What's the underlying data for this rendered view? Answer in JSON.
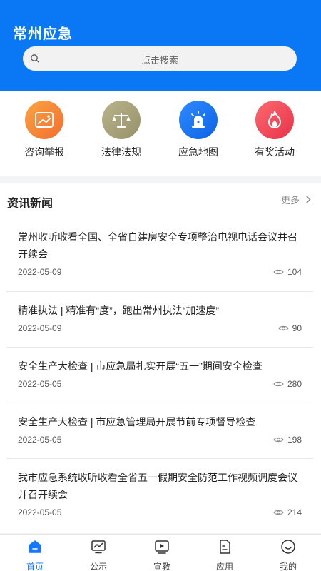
{
  "header": {
    "title": "常州应急",
    "search_placeholder": "点击搜索"
  },
  "quick_links": [
    {
      "label": "咨询举报",
      "icon": "report-icon",
      "color": "#f7873a"
    },
    {
      "label": "法律法规",
      "icon": "scale-icon",
      "color": "#a9a478"
    },
    {
      "label": "应急地图",
      "icon": "alarm-icon",
      "color": "#1677ff"
    },
    {
      "label": "有奖活动",
      "icon": "flame-icon",
      "color": "#f04a5a"
    }
  ],
  "news": {
    "title": "资讯新闻",
    "more": "更多",
    "items": [
      {
        "title": "常州收听收看全国、全省自建房安全专项整治电视电话会议并召开续会",
        "date": "2022-05-09",
        "views": "104"
      },
      {
        "title": "精准执法 | 精准有“度”，跑出常州执法“加速度”",
        "date": "2022-05-09",
        "views": "90"
      },
      {
        "title": "安全生产大检查 | 市应急局扎实开展“五一”期间安全检查",
        "date": "2022-05-05",
        "views": "280"
      },
      {
        "title": "安全生产大检查 | 市应急管理局开展节前专项督导检查",
        "date": "2022-05-05",
        "views": "198"
      },
      {
        "title": "我市应急系统收听收看全省五一假期安全防范工作视频调度会议并召开续会",
        "date": "2022-05-05",
        "views": "214"
      }
    ]
  },
  "tabbar": [
    {
      "label": "首页",
      "icon": "home-icon",
      "active": true
    },
    {
      "label": "公示",
      "icon": "chart-icon",
      "active": false
    },
    {
      "label": "宣教",
      "icon": "video-icon",
      "active": false
    },
    {
      "label": "应用",
      "icon": "app-icon",
      "active": false
    },
    {
      "label": "我的",
      "icon": "smile-icon",
      "active": false
    }
  ],
  "colors": {
    "primary": "#0a78f5",
    "tab_active": "#1677ff"
  }
}
